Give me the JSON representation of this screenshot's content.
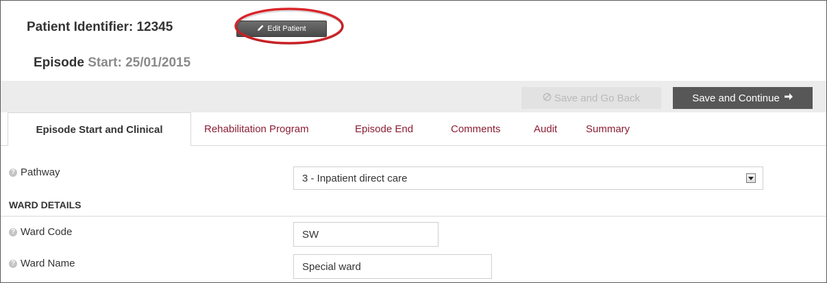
{
  "header": {
    "patient_identifier_label": "Patient Identifier: 12345",
    "edit_patient_label": "Edit Patient",
    "episode_label": "Episode",
    "episode_start": "Start: 25/01/2015"
  },
  "toolbar": {
    "save_back_label": "Save and Go Back",
    "save_continue_label": "Save and Continue"
  },
  "tabs": [
    {
      "label": "Episode Start and Clinical"
    },
    {
      "label": "Rehabilitation Program"
    },
    {
      "label": "Episode End"
    },
    {
      "label": "Comments"
    },
    {
      "label": "Audit"
    },
    {
      "label": "Summary"
    }
  ],
  "form": {
    "pathway_label": "Pathway",
    "pathway_value": "3 - Inpatient direct care",
    "ward_details_heading": "WARD DETAILS",
    "ward_code_label": "Ward Code",
    "ward_code_value": "SW",
    "ward_name_label": "Ward Name",
    "ward_name_value": "Special ward"
  },
  "colors": {
    "tab_link": "#8b1d33",
    "highlight": "#d9252a",
    "primary_button": "#575757"
  },
  "icons": {
    "edit": "pencil-icon",
    "back": "ban-icon",
    "continue": "arrow-right-icon",
    "help": "help-icon",
    "dropdown": "chevron-down-icon"
  }
}
